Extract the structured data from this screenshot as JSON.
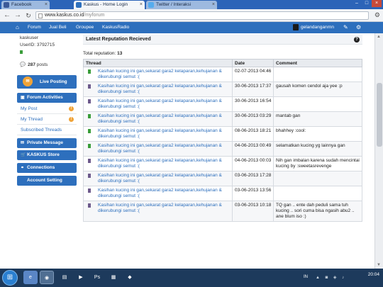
{
  "browser": {
    "tabs": [
      {
        "title": "Facebook",
        "active": false,
        "favicon_color": "#3b5998"
      },
      {
        "title": "Kaskus - Home Login",
        "active": true,
        "favicon_color": "#2d6fbd"
      },
      {
        "title": "Twitter / Interaksi",
        "active": false,
        "favicon_color": "#55acee"
      }
    ],
    "url_domain": "www.kaskus.co.id",
    "url_path": "/myforum"
  },
  "navbar": {
    "items": [
      "Forum",
      "Jual Beli",
      "Groupee",
      "KaskusRadio"
    ],
    "username": "gelandanganrnn"
  },
  "sidebar": {
    "user_label": "kaskuser",
    "user_id": "UserID: 3792715",
    "posts_count": "287",
    "posts_label": "posts",
    "live_posting": "Live Posting",
    "forum_activities": "Forum Activities",
    "sub_items": [
      "My Post",
      "My Thread",
      "Subscribed Threads"
    ],
    "buttons": [
      "Private Message",
      "KASKUS Store",
      "Connections",
      "Account Setting"
    ]
  },
  "content": {
    "title": "Latest Reputation Recieved",
    "total_label": "Total reputation:",
    "total_value": "13",
    "columns": [
      "Thread",
      "Date",
      "Comment"
    ],
    "rows": [
      {
        "thread": "Kasihan kucing ini gan,sekarat gara2 kelaparan,kehujanan & dikerubungi semut :(",
        "date": "02-07-2013 04:46",
        "comment": "",
        "rep": "pos"
      },
      {
        "thread": "Kasihan kucing ini gan,sekarat gara2 kelaparan,kehujanan & dikerubungi semut :(",
        "date": "30-06-2013 17:37",
        "comment": "gausah komen cendol aja yee :p",
        "rep": "neu"
      },
      {
        "thread": "Kasihan kucing ini gan,sekarat gara2 kelaparan,kehujanan & dikerubungi semut :(",
        "date": "30-06-2013 16:54",
        "comment": "",
        "rep": "neu"
      },
      {
        "thread": "Kasihan kucing ini gan,sekarat gara2 kelaparan,kehujanan & dikerubungi semut :(",
        "date": "30-06-2013 03:29",
        "comment": "mantab gan",
        "rep": "pos"
      },
      {
        "thread": "Kasihan kucing ini gan,sekarat gara2 kelaparan,kehujanan & dikerubungi semut :(",
        "date": "08-06-2013 18:21",
        "comment": "bhahhey :cool:",
        "rep": "pos"
      },
      {
        "thread": "Kasihan kucing ini gan,sekarat gara2 kelaparan,kehujanan & dikerubungi semut :(",
        "date": "04-06-2013 00:49",
        "comment": "selamatkan kucing yg lainnya gan",
        "rep": "pos"
      },
      {
        "thread": "Kasihan kucing ini gan,sekarat gara2 kelaparan,kehujanan & dikerubungi semut :(",
        "date": "04-06-2013 00:03",
        "comment": "Nih gan imbalan karena sudah mencintai kucing by :sweetasrevenge",
        "rep": "neu"
      },
      {
        "thread": "Kasihan kucing ini gan,sekarat gara2 kelaparan,kehujanan & dikerubungi semut :(",
        "date": "03-06-2013 17:28",
        "comment": "",
        "rep": "neu"
      },
      {
        "thread": "Kasihan kucing ini gan,sekarat gara2 kelaparan,kehujanan & dikerubungi semut :(",
        "date": "03-06-2013 13:56",
        "comment": "",
        "rep": "neu"
      },
      {
        "thread": "Kasihan kucing ini gan,sekarat gara2 kelaparan,kehujanan & dikerubungi semut :(",
        "date": "03-06-2013 10:18",
        "comment": "TQ gan .. ente dah peduli sama tuh kucing .. sori cuma bisa ngasih abu2 .. ane blum iso :)",
        "rep": "neu"
      }
    ]
  },
  "taskbar": {
    "lang": "IN",
    "time": "20:04"
  }
}
